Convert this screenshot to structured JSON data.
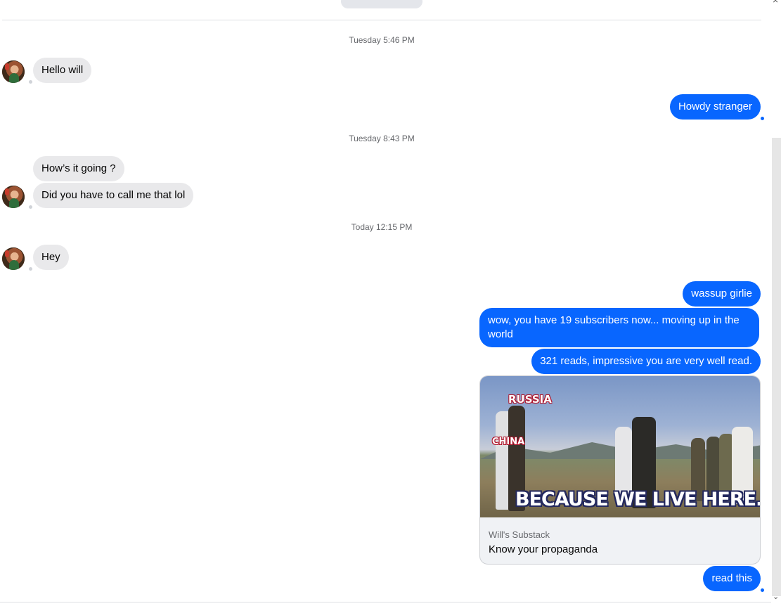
{
  "close_glyph": "×",
  "scroll_down_glyph": "⌄",
  "timestamps": [
    "Tuesday 5:46 PM",
    "Tuesday 8:43 PM",
    "Today 12:15 PM"
  ],
  "messages": {
    "m1": "Hello will",
    "m2": "Howdy stranger",
    "m3": "How’s it going ?",
    "m4": "Did you have to call me that lol",
    "m5": "Hey",
    "m6": "wassup girlie",
    "m7": "wow, you have 19 subscribers now... moving up in the world",
    "m8": "321 reads, impressive you are very well read.",
    "m9": "read this"
  },
  "link_preview": {
    "source": "Will's Substack",
    "title": "Know your propaganda",
    "image_labels": {
      "label_1": "RUSSIA",
      "label_2": "CHINA",
      "caption": "BECAUSE WE LIVE HERE."
    }
  },
  "colors": {
    "outgoing_bubble": "#0866ff",
    "incoming_bubble": "#e9e9eb",
    "timestamp_text": "#65676b"
  }
}
